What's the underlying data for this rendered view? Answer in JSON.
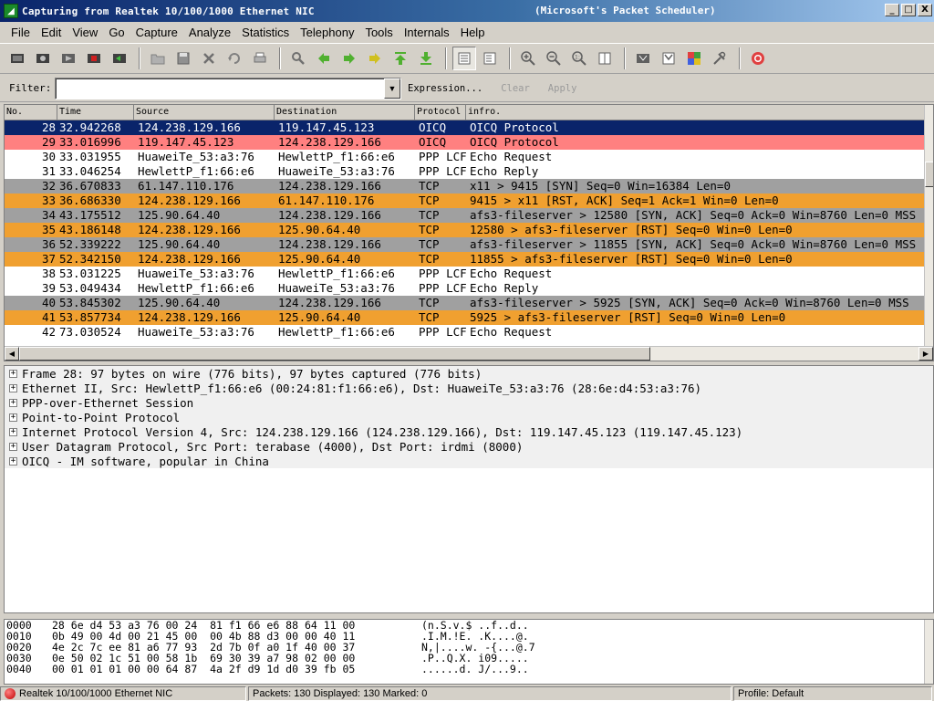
{
  "window": {
    "title": "Capturing from Realtek 10/100/1000 Ethernet NIC",
    "title_right": "(Microsoft's Packet Scheduler)",
    "minimize": "_",
    "maximize": "□",
    "close": "X"
  },
  "menu": [
    "File",
    "Edit",
    "View",
    "Go",
    "Capture",
    "Analyze",
    "Statistics",
    "Telephony",
    "Tools",
    "Internals",
    "Help"
  ],
  "filter": {
    "label": "Filter:",
    "value": "",
    "expression": "Expression...",
    "clear": "Clear",
    "apply": "Apply"
  },
  "columns": {
    "no": "No.",
    "time": "Time",
    "source": "Source",
    "destination": "Destination",
    "protocol": "Protocol",
    "info": "infro."
  },
  "packets": [
    {
      "no": "28",
      "time": "32.942268",
      "src": "124.238.129.166",
      "dst": "119.147.45.123",
      "proto": "OICQ",
      "info": "OICQ Protocol",
      "bg": "#0a246a",
      "fg": "#ffffff"
    },
    {
      "no": "29",
      "time": "33.016996",
      "src": "119.147.45.123",
      "dst": "124.238.129.166",
      "proto": "OICQ",
      "info": "OICQ Protocol",
      "bg": "#ff8080",
      "fg": "#000000"
    },
    {
      "no": "30",
      "time": "33.031955",
      "src": "HuaweiTe_53:a3:76",
      "dst": "HewlettP_f1:66:e6",
      "proto": "PPP LCF",
      "info": "Echo Request",
      "bg": "#ffffff",
      "fg": "#000000"
    },
    {
      "no": "31",
      "time": "33.046254",
      "src": "HewlettP_f1:66:e6",
      "dst": "HuaweiTe_53:a3:76",
      "proto": "PPP LCF",
      "info": "Echo Reply",
      "bg": "#ffffff",
      "fg": "#000000"
    },
    {
      "no": "32",
      "time": "36.670833",
      "src": "61.147.110.176",
      "dst": "124.238.129.166",
      "proto": "TCP",
      "info": "x11 > 9415 [SYN] Seq=0 Win=16384 Len=0",
      "bg": "#a0a0a0",
      "fg": "#000000"
    },
    {
      "no": "33",
      "time": "36.686330",
      "src": "124.238.129.166",
      "dst": "61.147.110.176",
      "proto": "TCP",
      "info": "9415 > x11 [RST, ACK] Seq=1 Ack=1 Win=0 Len=0",
      "bg": "#f0a030",
      "fg": "#000000"
    },
    {
      "no": "34",
      "time": "43.175512",
      "src": "125.90.64.40",
      "dst": "124.238.129.166",
      "proto": "TCP",
      "info": "afs3-fileserver > 12580 [SYN, ACK] Seq=0 Ack=0 Win=8760 Len=0 MSS",
      "bg": "#a0a0a0",
      "fg": "#000000"
    },
    {
      "no": "35",
      "time": "43.186148",
      "src": "124.238.129.166",
      "dst": "125.90.64.40",
      "proto": "TCP",
      "info": "12580 > afs3-fileserver [RST] Seq=0 Win=0 Len=0",
      "bg": "#f0a030",
      "fg": "#000000"
    },
    {
      "no": "36",
      "time": "52.339222",
      "src": "125.90.64.40",
      "dst": "124.238.129.166",
      "proto": "TCP",
      "info": "afs3-fileserver > 11855 [SYN, ACK] Seq=0 Ack=0 Win=8760 Len=0 MSS",
      "bg": "#a0a0a0",
      "fg": "#000000"
    },
    {
      "no": "37",
      "time": "52.342150",
      "src": "124.238.129.166",
      "dst": "125.90.64.40",
      "proto": "TCP",
      "info": "11855 > afs3-fileserver [RST] Seq=0 Win=0 Len=0",
      "bg": "#f0a030",
      "fg": "#000000"
    },
    {
      "no": "38",
      "time": "53.031225",
      "src": "HuaweiTe_53:a3:76",
      "dst": "HewlettP_f1:66:e6",
      "proto": "PPP LCF",
      "info": "Echo Request",
      "bg": "#ffffff",
      "fg": "#000000"
    },
    {
      "no": "39",
      "time": "53.049434",
      "src": "HewlettP_f1:66:e6",
      "dst": "HuaweiTe_53:a3:76",
      "proto": "PPP LCF",
      "info": "Echo Reply",
      "bg": "#ffffff",
      "fg": "#000000"
    },
    {
      "no": "40",
      "time": "53.845302",
      "src": "125.90.64.40",
      "dst": "124.238.129.166",
      "proto": "TCP",
      "info": "afs3-fileserver > 5925 [SYN, ACK] Seq=0 Ack=0 Win=8760 Len=0 MSS",
      "bg": "#a0a0a0",
      "fg": "#000000"
    },
    {
      "no": "41",
      "time": "53.857734",
      "src": "124.238.129.166",
      "dst": "125.90.64.40",
      "proto": "TCP",
      "info": "5925 > afs3-fileserver [RST] Seq=0 Win=0 Len=0",
      "bg": "#f0a030",
      "fg": "#000000"
    },
    {
      "no": "42",
      "time": "73.030524",
      "src": "HuaweiTe_53:a3:76",
      "dst": "HewlettP_f1:66:e6",
      "proto": "PPP LCF",
      "info": "Echo Request",
      "bg": "#ffffff",
      "fg": "#000000"
    }
  ],
  "details": [
    "Frame 28: 97 bytes on wire (776 bits), 97 bytes captured (776 bits)",
    "Ethernet II, Src: HewlettP_f1:66:e6 (00:24:81:f1:66:e6), Dst: HuaweiTe_53:a3:76 (28:6e:d4:53:a3:76)",
    "PPP-over-Ethernet Session",
    "Point-to-Point Protocol",
    "Internet Protocol Version 4, Src: 124.238.129.166 (124.238.129.166), Dst: 119.147.45.123 (119.147.45.123)",
    "User Datagram Protocol, Src Port: terabase (4000), Dst Port: irdmi (8000)",
    "OICQ - IM software, popular in China"
  ],
  "hex": [
    {
      "off": "0000",
      "bytes": "28 6e d4 53 a3 76 00 24  81 f1 66 e6 88 64 11 00",
      "ascii": "(n.S.v.$ ..f..d.."
    },
    {
      "off": "0010",
      "bytes": "0b 49 00 4d 00 21 45 00  00 4b 88 d3 00 00 40 11",
      "ascii": ".I.M.!E. .K....@."
    },
    {
      "off": "0020",
      "bytes": "4e 2c 7c ee 81 a6 77 93  2d 7b 0f a0 1f 40 00 37",
      "ascii": "N,|....w. -{...@.7"
    },
    {
      "off": "0030",
      "bytes": "0e 50 02 1c 51 00 58 1b  69 30 39 a7 98 02 00 00",
      "ascii": ".P..Q.X. i09....."
    },
    {
      "off": "0040",
      "bytes": "00 01 01 01 00 00 64 87  4a 2f d9 1d d0 39 fb 05",
      "ascii": "......d. J/...9.."
    }
  ],
  "status": {
    "interface": "Realtek 10/100/1000 Ethernet NIC",
    "packets": "Packets: 130 Displayed: 130 Marked: 0",
    "profile": "Profile: Default"
  }
}
